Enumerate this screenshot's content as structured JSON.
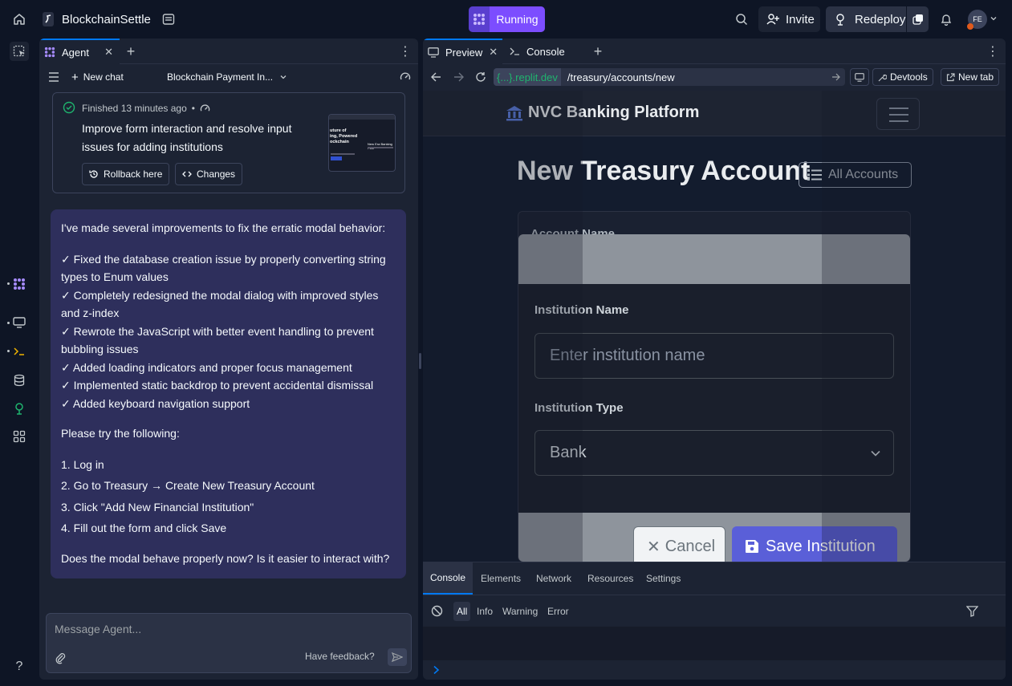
{
  "topbar": {
    "app_title": "BlockchainSettle",
    "run_label": "Running",
    "invite_label": "Invite",
    "redeploy_label": "Redeploy",
    "avatar_initials": "FE"
  },
  "agent": {
    "tab_label": "Agent",
    "new_chat_label": "New chat",
    "chat_title": "Blockchain Payment In...",
    "checkpoint": {
      "status": "Finished 13 minutes ago",
      "separator": "•",
      "title": "Improve form interaction and resolve input issues for adding institutions",
      "rollback_label": "Rollback here",
      "changes_label": "Changes",
      "thumb_lines": [
        "uture of",
        "ing, Powered",
        "ockchain"
      ],
      "thumb_right": "New Era Banking Platf"
    },
    "message": {
      "intro": "I've made several improvements to fix the erratic modal behavior:",
      "items": [
        "✓ Fixed the database creation issue by properly converting string types to Enum values",
        "✓ Completely redesigned the modal dialog with improved styles and z-index",
        "✓ Rewrote the JavaScript with better event handling to prevent bubbling issues",
        "✓ Added loading indicators and proper focus management",
        "✓ Implemented static backdrop to prevent accidental dismissal",
        "✓ Added keyboard navigation support"
      ],
      "instructions_title": "Please try the following:",
      "steps": [
        "1. Log in",
        "2. Go to Treasury → Create New Treasury Account",
        "3. Click \"Add New Financial Institution\"",
        "4. Fill out the form and click Save"
      ],
      "question": "Does the modal behave properly now? Is it easier to interact with?"
    },
    "input_placeholder": "Message Agent...",
    "feedback_label": "Have feedback?"
  },
  "preview": {
    "tab_preview": "Preview",
    "tab_console": "Console",
    "url_host_open": "{...}",
    "url_host_rest": ".replit.dev",
    "url_path": "/treasury/accounts/new",
    "devtools_label": "Devtools",
    "newtab_label": "New tab",
    "site": {
      "brand": "NVC Banking Platform",
      "heading": "New Treasury Account",
      "all_accounts": "All Accounts",
      "account_name_label": "Account Name",
      "modal": {
        "inst_name_label": "Institution Name",
        "inst_name_placeholder": "Enter institution name",
        "inst_type_label": "Institution Type",
        "inst_type_value": "Bank",
        "cancel_label": "Cancel",
        "save_label": "Save Institution"
      }
    }
  },
  "devtools": {
    "tabs": [
      "Console",
      "Elements",
      "Network",
      "Resources",
      "Settings"
    ],
    "filters": [
      "All",
      "Info",
      "Warning",
      "Error"
    ]
  },
  "colors": {
    "accent_purple": "#7c4dff",
    "bg": "#0e1525",
    "panel": "#1c2333",
    "message_bg": "#2e2f5c"
  }
}
